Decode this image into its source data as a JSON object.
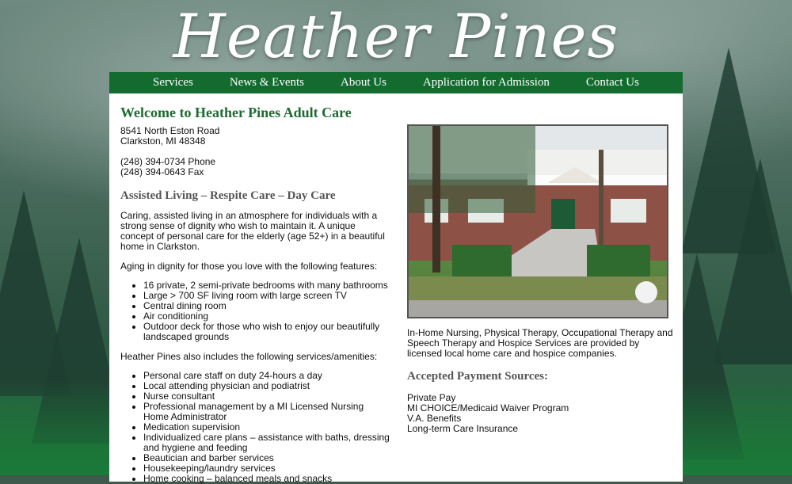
{
  "site": {
    "title": "Heather Pines"
  },
  "nav": {
    "items": [
      {
        "label": "Services"
      },
      {
        "label": "News & Events"
      },
      {
        "label": "About Us"
      },
      {
        "label": "Application for Admission"
      },
      {
        "label": "Contact Us"
      }
    ]
  },
  "main": {
    "welcome_title": "Welcome to Heather Pines Adult Care",
    "address_line1": "8541 North Eston Road",
    "address_line2": "Clarkston, MI 48348",
    "phone": "(248) 394-0734 Phone",
    "fax": "(248) 394-0643 Fax",
    "subtitle": "Assisted Living – Respite Care – Day Care",
    "intro": "Caring, assisted living in an atmosphere for individuals with a strong sense of dignity who wish to maintain it. A unique concept of personal care for the elderly (age 52+) in a beautiful home in Clarkston.",
    "features_intro": "Aging in dignity for those you love with the following features:",
    "features": [
      "16 private, 2 semi-private bedrooms with many bathrooms",
      "Large > 700 SF living room with large screen TV",
      "Central dining room",
      "Air conditioning",
      "Outdoor deck for those who wish to enjoy our beautifully landscaped grounds"
    ],
    "services_intro": "Heather Pines also includes the following services/amenities:",
    "services": [
      "Personal care staff on duty 24-hours a day",
      "Local attending physician and podiatrist",
      "Nurse consultant",
      "Professional management by a MI Licensed Nursing Home Administrator",
      "Medication supervision",
      "Individualized care plans – assistance with baths, dressing and hygiene and feeding",
      "Beautician and barber services",
      "Housekeeping/laundry services",
      "Home cooking – balanced meals and snacks"
    ]
  },
  "sidebar": {
    "therapy_text": "In-Home Nursing, Physical Therapy, Occupational Therapy and Speech Therapy and Hospice Services are provided by licensed local home care and hospice companies.",
    "payment_title": "Accepted Payment Sources:",
    "payment_sources": [
      "Private Pay",
      "MI CHOICE/Medicaid Waiver Program",
      "V.A. Benefits",
      "Long-term Care Insurance"
    ]
  }
}
